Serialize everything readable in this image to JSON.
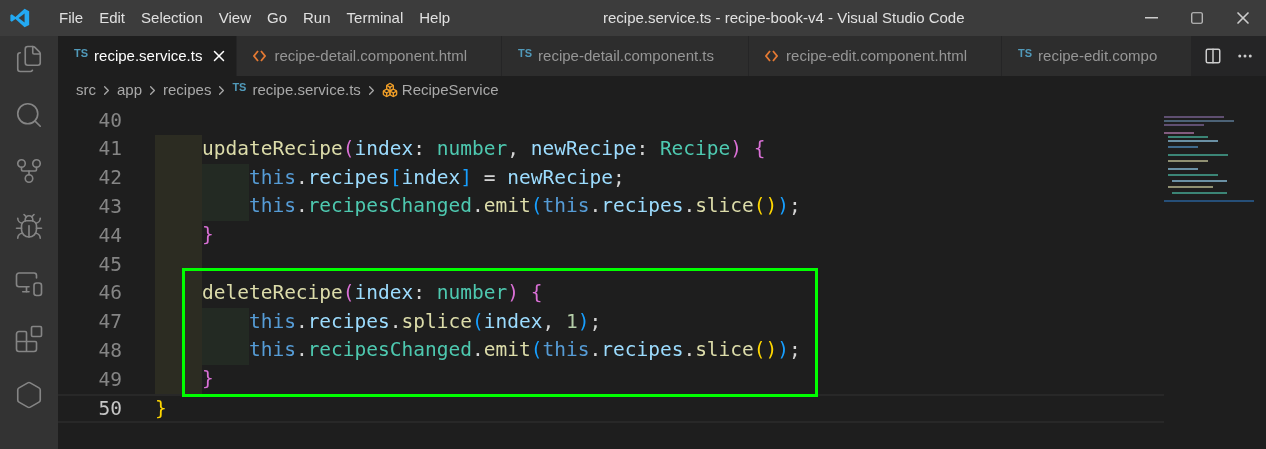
{
  "menu": [
    "File",
    "Edit",
    "Selection",
    "View",
    "Go",
    "Run",
    "Terminal",
    "Help"
  ],
  "window": {
    "title": "recipe.service.ts - recipe-book-v4 - Visual Studio Code"
  },
  "activity_bar": [
    {
      "kind": "files",
      "selected": false
    },
    {
      "kind": "search",
      "selected": false
    },
    {
      "kind": "source-control",
      "selected": false
    },
    {
      "kind": "debug",
      "selected": false
    },
    {
      "kind": "remote",
      "selected": false
    },
    {
      "kind": "extensions",
      "selected": false
    },
    {
      "kind": "testing",
      "selected": false
    }
  ],
  "tabs": [
    {
      "kind": "ts",
      "badge": "TS",
      "label": "recipe.service.ts",
      "selected": true
    },
    {
      "kind": "html",
      "label": "recipe-detail.component.html",
      "selected": false
    },
    {
      "kind": "ts",
      "badge": "TS",
      "label": "recipe-detail.component.ts",
      "selected": false
    },
    {
      "kind": "html",
      "label": "recipe-edit.component.html",
      "selected": false
    },
    {
      "kind": "ts",
      "badge": "TS",
      "label": "recipe-edit.compo",
      "selected": false
    }
  ],
  "breadcrumbs": [
    {
      "kind": "folder",
      "label": "src"
    },
    {
      "kind": "folder",
      "label": "app"
    },
    {
      "kind": "folder",
      "label": "recipes"
    },
    {
      "kind": "ts",
      "badge": "TS",
      "label": "recipe.service.ts"
    },
    {
      "kind": "class",
      "label": "RecipeService"
    }
  ],
  "lines": [
    {
      "number": "40",
      "current": false,
      "highlighted": false
    },
    {
      "number": "41",
      "current": false,
      "highlighted": false,
      "tokens": [
        {
          "kind": "indent"
        },
        {
          "kind": "function",
          "text": "updateRecipe"
        },
        {
          "kind": "bracket2",
          "text": "("
        },
        {
          "kind": "param",
          "text": "index"
        },
        {
          "kind": "punct",
          "text": ": "
        },
        {
          "kind": "type",
          "text": "number"
        },
        {
          "kind": "punct",
          "text": ", "
        },
        {
          "kind": "param",
          "text": "newRecipe"
        },
        {
          "kind": "punct",
          "text": ": "
        },
        {
          "kind": "type",
          "text": "Recipe"
        },
        {
          "kind": "bracket2",
          "text": ")"
        },
        {
          "kind": "bracket2",
          "text": " {"
        }
      ]
    },
    {
      "number": "42",
      "current": false,
      "highlighted": false,
      "tokens": [
        {
          "kind": "indent"
        },
        {
          "kind": "indent2"
        },
        {
          "kind": "keyword",
          "text": "this"
        },
        {
          "kind": "punct",
          "text": "."
        },
        {
          "kind": "param",
          "text": "recipes"
        },
        {
          "kind": "bracket3",
          "text": "["
        },
        {
          "kind": "param",
          "text": "index"
        },
        {
          "kind": "bracket3",
          "text": "]"
        },
        {
          "kind": "punct",
          "text": " = "
        },
        {
          "kind": "param",
          "text": "newRecipe"
        },
        {
          "kind": "punct",
          "text": ";"
        }
      ]
    },
    {
      "number": "43",
      "current": false,
      "highlighted": false,
      "tokens": [
        {
          "kind": "indent"
        },
        {
          "kind": "indent2"
        },
        {
          "kind": "keyword",
          "text": "this"
        },
        {
          "kind": "punct",
          "text": "."
        },
        {
          "kind": "type",
          "text": "recipesChanged"
        },
        {
          "kind": "punct",
          "text": "."
        },
        {
          "kind": "function",
          "text": "emit"
        },
        {
          "kind": "bracket3",
          "text": "("
        },
        {
          "kind": "keyword",
          "text": "this"
        },
        {
          "kind": "punct",
          "text": "."
        },
        {
          "kind": "param",
          "text": "recipes"
        },
        {
          "kind": "punct",
          "text": "."
        },
        {
          "kind": "function",
          "text": "slice"
        },
        {
          "kind": "bracket1",
          "text": "()"
        },
        {
          "kind": "bracket3",
          "text": ")"
        },
        {
          "kind": "punct",
          "text": ";"
        }
      ]
    },
    {
      "number": "44",
      "current": false,
      "highlighted": false,
      "tokens": [
        {
          "kind": "indent"
        },
        {
          "kind": "bracket2",
          "text": "}"
        }
      ]
    },
    {
      "number": "45",
      "current": false,
      "highlighted": false,
      "tokens": [
        {
          "kind": "indent"
        }
      ]
    },
    {
      "number": "46",
      "current": false,
      "highlighted": true,
      "tokens": [
        {
          "kind": "indent"
        },
        {
          "kind": "function",
          "text": "deleteRecipe"
        },
        {
          "kind": "bracket2",
          "text": "("
        },
        {
          "kind": "param",
          "text": "index"
        },
        {
          "kind": "punct",
          "text": ": "
        },
        {
          "kind": "type",
          "text": "number"
        },
        {
          "kind": "bracket2",
          "text": ")"
        },
        {
          "kind": "bracket2",
          "text": " {"
        }
      ]
    },
    {
      "number": "47",
      "current": false,
      "highlighted": true,
      "tokens": [
        {
          "kind": "indent"
        },
        {
          "kind": "indent2"
        },
        {
          "kind": "keyword",
          "text": "this"
        },
        {
          "kind": "punct",
          "text": "."
        },
        {
          "kind": "param",
          "text": "recipes"
        },
        {
          "kind": "punct",
          "text": "."
        },
        {
          "kind": "function",
          "text": "splice"
        },
        {
          "kind": "bracket3",
          "text": "("
        },
        {
          "kind": "param",
          "text": "index"
        },
        {
          "kind": "punct",
          "text": ", "
        },
        {
          "kind": "number",
          "text": "1"
        },
        {
          "kind": "bracket3",
          "text": ")"
        },
        {
          "kind": "punct",
          "text": ";"
        }
      ]
    },
    {
      "number": "48",
      "current": false,
      "highlighted": true,
      "tokens": [
        {
          "kind": "indent"
        },
        {
          "kind": "indent2"
        },
        {
          "kind": "keyword",
          "text": "this"
        },
        {
          "kind": "punct",
          "text": "."
        },
        {
          "kind": "type",
          "text": "recipesChanged"
        },
        {
          "kind": "punct",
          "text": "."
        },
        {
          "kind": "function",
          "text": "emit"
        },
        {
          "kind": "bracket3",
          "text": "("
        },
        {
          "kind": "keyword",
          "text": "this"
        },
        {
          "kind": "punct",
          "text": "."
        },
        {
          "kind": "param",
          "text": "recipes"
        },
        {
          "kind": "punct",
          "text": "."
        },
        {
          "kind": "function",
          "text": "slice"
        },
        {
          "kind": "bracket1",
          "text": "()"
        },
        {
          "kind": "bracket3",
          "text": ")"
        },
        {
          "kind": "punct",
          "text": ";"
        }
      ]
    },
    {
      "number": "49",
      "current": false,
      "highlighted": true,
      "tokens": [
        {
          "kind": "indent"
        },
        {
          "kind": "bracket2",
          "text": "}"
        }
      ]
    },
    {
      "number": "50",
      "current": true,
      "highlighted": false,
      "tokens": [
        {
          "kind": "bracket1",
          "text": "}"
        }
      ]
    }
  ]
}
